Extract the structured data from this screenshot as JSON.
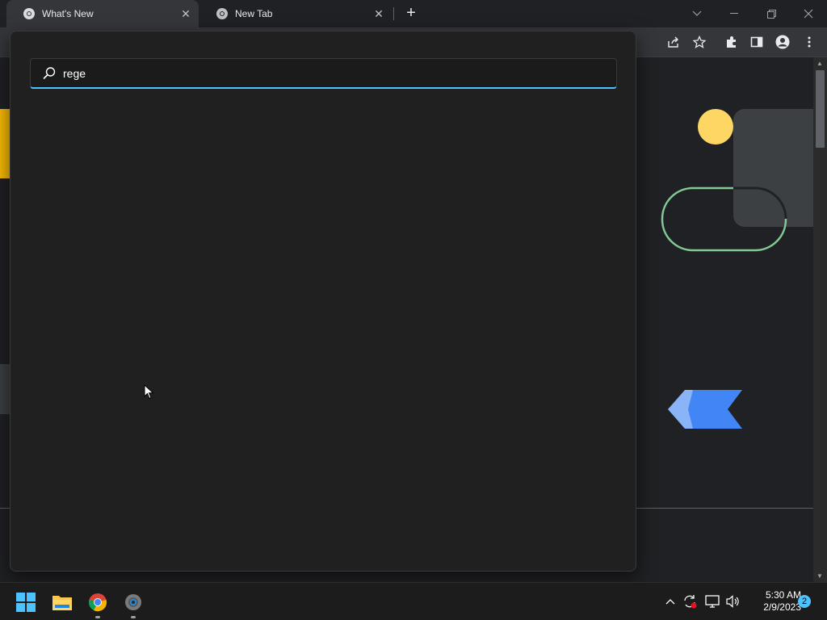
{
  "browser": {
    "tabs": [
      {
        "title": "What's New",
        "active": true,
        "icon": "chrome-icon"
      },
      {
        "title": "New Tab",
        "active": false,
        "icon": "chrome-icon"
      }
    ],
    "toolbar_icons": [
      "share-icon",
      "bookmark-star-icon",
      "extensions-icon",
      "side-panel-icon",
      "profile-icon",
      "menu-icon"
    ]
  },
  "search": {
    "query": "rege",
    "accent": "#4cc2ff"
  },
  "page_decor": {
    "colors": {
      "yellow": "#fdd663",
      "green": "#81c995",
      "blue": "#4285f4",
      "light_blue": "#8ab4f8",
      "panel": "#3c4043"
    }
  },
  "taskbar": {
    "apps": [
      "start-icon",
      "file-explorer-icon",
      "chrome-icon",
      "settings-icon"
    ],
    "time": "5:30 AM",
    "date": "2/9/2023",
    "notification_count": "2"
  }
}
